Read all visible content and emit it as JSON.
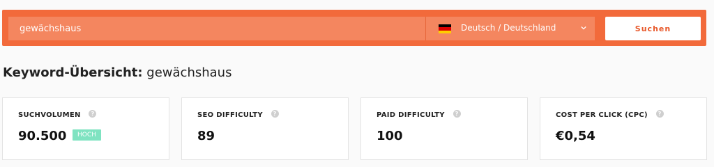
{
  "search": {
    "keyword_value": "gewächshaus",
    "locale_label": "Deutsch / Deutschland",
    "submit_label": "Suchen"
  },
  "overview": {
    "title_prefix": "Keyword-Übersicht:",
    "title_keyword": "gewächshaus"
  },
  "cards": [
    {
      "label": "SUCHVOLUMEN",
      "value": "90.500",
      "badge": "HOCH",
      "help_icon": "question-icon"
    },
    {
      "label": "SEO DIFFICULTY",
      "value": "89",
      "help_icon": "question-icon"
    },
    {
      "label": "PAID DIFFICULTY",
      "value": "100",
      "help_icon": "question-icon"
    },
    {
      "label": "COST PER CLICK (CPC)",
      "value": "€0,54",
      "help_icon": "question-icon"
    }
  ],
  "colors": {
    "accent": "#f26a3b",
    "input_bg": "#f4865f",
    "badge": "#7fe3c1"
  },
  "icons": {
    "flag": "germany-flag-icon",
    "dropdown": "chevron-down-icon",
    "help": "question-icon"
  }
}
